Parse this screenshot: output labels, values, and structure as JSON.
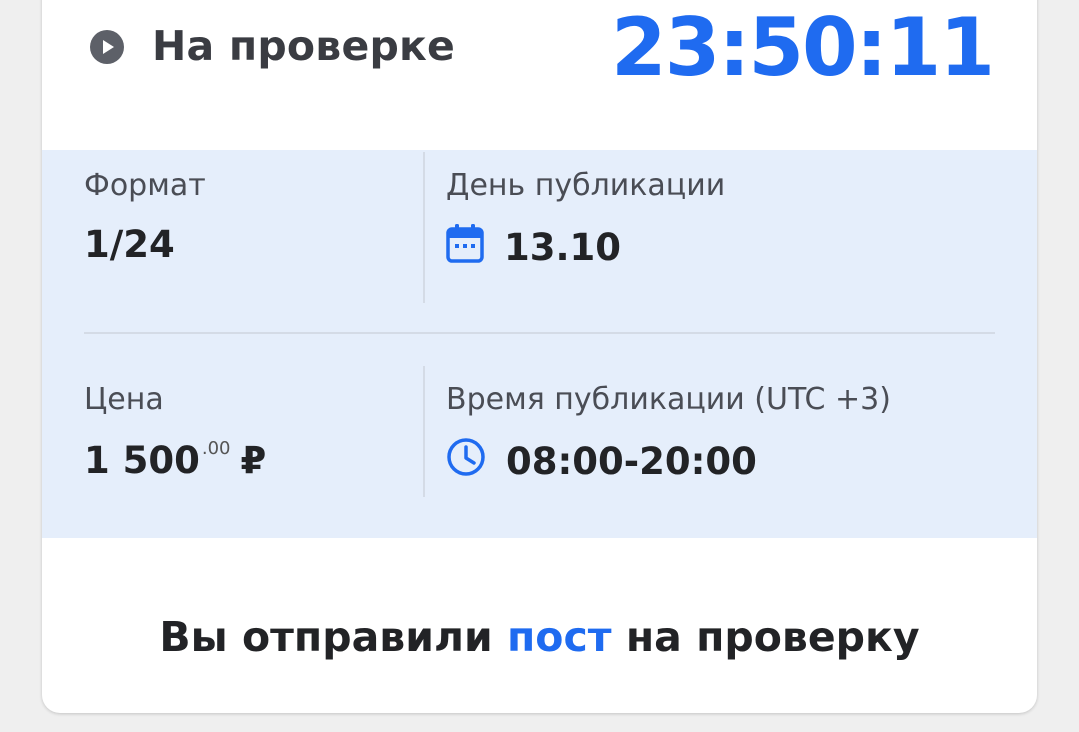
{
  "status": {
    "icon": "play-circle-icon",
    "label": "На проверке",
    "timer": "23:50:11"
  },
  "details": {
    "format": {
      "label": "Формат",
      "value": "1/24"
    },
    "publication_day": {
      "label": "День публикации",
      "icon": "calendar-icon",
      "value": "13.10"
    },
    "price": {
      "label": "Цена",
      "value_main": "1 500",
      "value_cents": ".00",
      "currency": "₽"
    },
    "publication_time": {
      "label": "Время публикации (UTC +3)",
      "icon": "clock-icon",
      "value": "08:00-20:00"
    }
  },
  "message": {
    "prefix": "Вы отправили ",
    "highlight": "пост",
    "suffix": " на проверку"
  },
  "colors": {
    "accent": "#1f6bf0",
    "panel_bg": "#e5eefb",
    "text": "#222326",
    "muted": "#4a4d55"
  }
}
